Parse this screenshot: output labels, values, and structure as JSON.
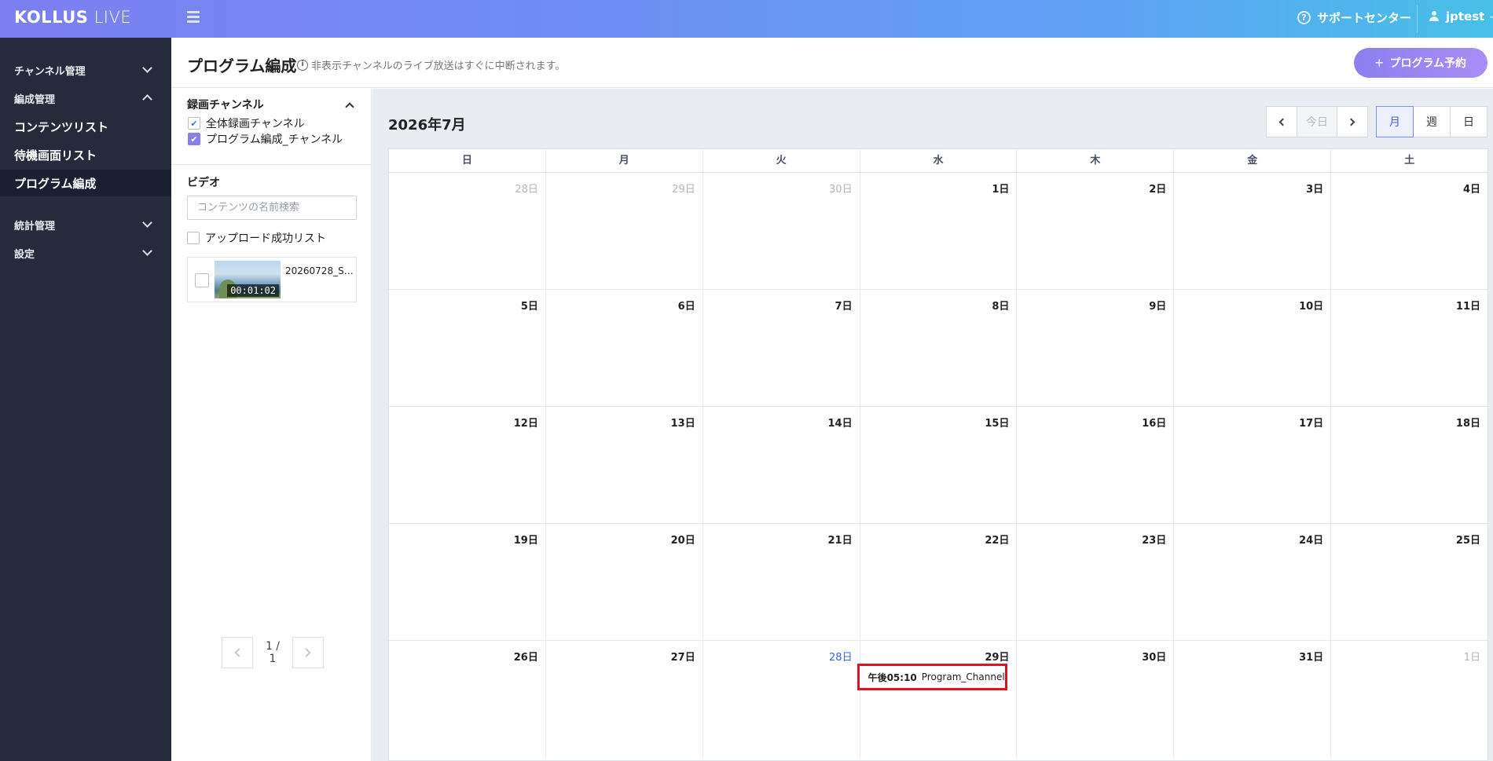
{
  "header": {
    "logo_bold": "KOLLUS",
    "logo_light": "LIVE",
    "support_label": "サポートセンター",
    "user_name": "jptest"
  },
  "sidebar": {
    "items": [
      {
        "label": "チャンネル管理"
      },
      {
        "label": "編成管理"
      },
      {
        "label": "コンテンツリスト"
      },
      {
        "label": "待機画面リスト"
      },
      {
        "label": "プログラム編成"
      },
      {
        "label": "統計管理"
      },
      {
        "label": "設定"
      }
    ]
  },
  "page": {
    "title": "プログラム編成",
    "note": "非表示チャンネルのライブ放送はすぐに中断されます。",
    "reserve_label": "プログラム予約"
  },
  "panel": {
    "channels_title": "録画チャンネル",
    "channels": [
      {
        "label": "全体録画チャンネル",
        "checked": true
      },
      {
        "label": "プログラム編成_チャンネル",
        "checked": true
      }
    ],
    "video_title": "ビデオ",
    "search_placeholder": "コンテンツの名前検索",
    "upload_success_label": "アップロード成功リスト",
    "videos": [
      {
        "title": "20260728_Sa...",
        "duration": "00:01:02"
      }
    ],
    "pager_text": "1 / 1"
  },
  "calendar": {
    "month_title": "2026年7月",
    "today_label": "今日",
    "views": [
      "月",
      "週",
      "日"
    ],
    "weekdays": [
      "日",
      "月",
      "火",
      "水",
      "木",
      "金",
      "土"
    ],
    "weeks": [
      [
        "28日",
        "29日",
        "30日",
        "1日",
        "2日",
        "3日",
        "4日"
      ],
      [
        "5日",
        "6日",
        "7日",
        "8日",
        "9日",
        "10日",
        "11日"
      ],
      [
        "12日",
        "13日",
        "14日",
        "15日",
        "16日",
        "17日",
        "18日"
      ],
      [
        "19日",
        "20日",
        "21日",
        "22日",
        "23日",
        "24日",
        "25日"
      ],
      [
        "26日",
        "27日",
        "28日",
        "29日",
        "30日",
        "31日",
        "1日"
      ]
    ],
    "event": {
      "time": "午後05:10",
      "name": "Program_Channel"
    }
  },
  "colors": {
    "accent": "#8a7fe8",
    "today_blue": "#3f63d8",
    "highlight_red": "#e0141e",
    "sidebar_bg": "#252b3b"
  }
}
